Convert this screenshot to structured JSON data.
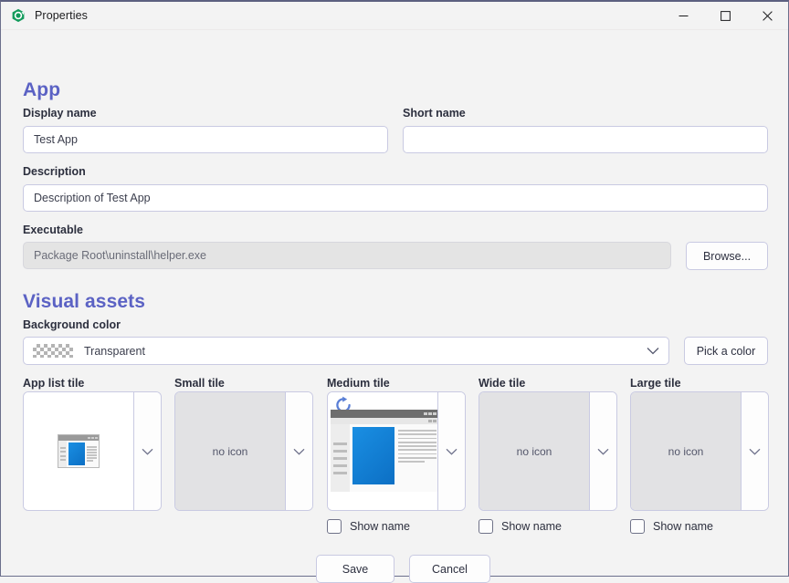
{
  "window": {
    "title": "Properties",
    "app_icon": "green-hex-logo-icon",
    "controls": {
      "minimize": "minimize-icon",
      "maximize": "maximize-icon",
      "close": "close-icon"
    }
  },
  "sections": {
    "app": {
      "heading": "App",
      "fields": {
        "display_name": {
          "label": "Display name",
          "value": "Test App",
          "placeholder": ""
        },
        "short_name": {
          "label": "Short name",
          "value": "",
          "placeholder": ""
        },
        "description": {
          "label": "Description",
          "value": "Description of Test App",
          "placeholder": ""
        },
        "executable": {
          "label": "Executable",
          "value": "Package Root\\uninstall\\helper.exe",
          "placeholder": "",
          "disabled": true
        }
      },
      "browse_button": "Browse..."
    },
    "visual_assets": {
      "heading": "Visual assets",
      "background_color": {
        "label": "Background color",
        "selected": "Transparent",
        "swatch": "transparent-checkerboard-swatch",
        "pick_button": "Pick a color"
      },
      "tiles": [
        {
          "label": "App list tile",
          "state": "has-icon",
          "placeholder": "",
          "show_name": null
        },
        {
          "label": "Small tile",
          "state": "empty",
          "placeholder": "no icon",
          "show_name": null
        },
        {
          "label": "Medium tile",
          "state": "has-icon",
          "placeholder": "",
          "show_name": "Show name"
        },
        {
          "label": "Wide tile",
          "state": "empty",
          "placeholder": "no icon",
          "show_name": "Show name"
        },
        {
          "label": "Large tile",
          "state": "empty",
          "placeholder": "no icon",
          "show_name": "Show name"
        }
      ]
    }
  },
  "footer": {
    "save_label": "Save",
    "cancel_label": "Cancel"
  },
  "colors": {
    "section_heading": "#5b62c4",
    "window_background": "#f3f3f3",
    "field_border": "#c9cae2",
    "tile_empty_fill": "#e2e2e4",
    "accent_blue": "#0c6fc4",
    "app_icon_green": "#139b5c"
  }
}
